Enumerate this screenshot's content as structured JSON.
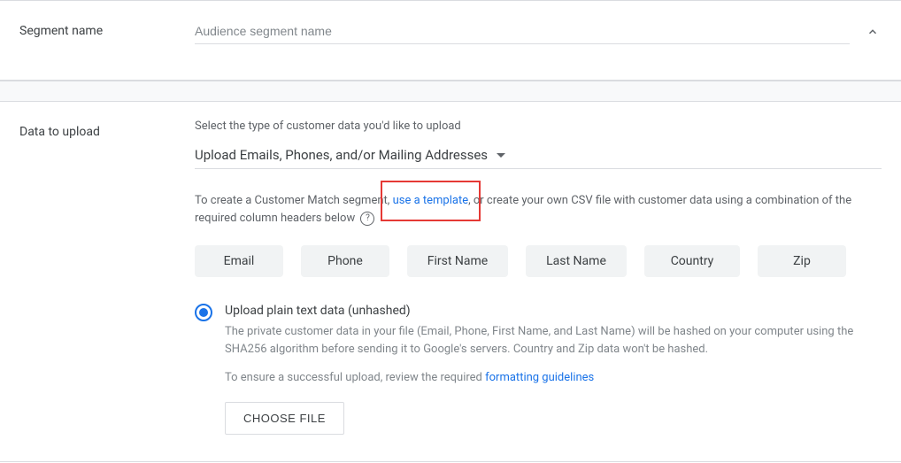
{
  "segment": {
    "label": "Segment name",
    "placeholder": "Audience segment name",
    "value": ""
  },
  "upload": {
    "label": "Data to upload",
    "prompt": "Select the type of customer data you'd like to upload",
    "dropdown_value": "Upload Emails, Phones, and/or Mailing Addresses",
    "desc_pre": "To create a Customer Match segment, ",
    "desc_link": "use a template",
    "desc_post": ", or create your own CSV file with customer data using a combination of the required column headers below",
    "columns": [
      "Email",
      "Phone",
      "First Name",
      "Last Name",
      "Country",
      "Zip"
    ],
    "radio": {
      "label": "Upload plain text data (unhashed)",
      "desc": "The private customer data in your file (Email, Phone, First Name, and Last Name) will be hashed on your computer using the SHA256 algorithm before sending it to Google's servers. Country and Zip data won't be hashed.",
      "note_pre": "To ensure a successful upload, review the required ",
      "note_link": "formatting guidelines"
    },
    "choose_file": "CHOOSE FILE"
  }
}
